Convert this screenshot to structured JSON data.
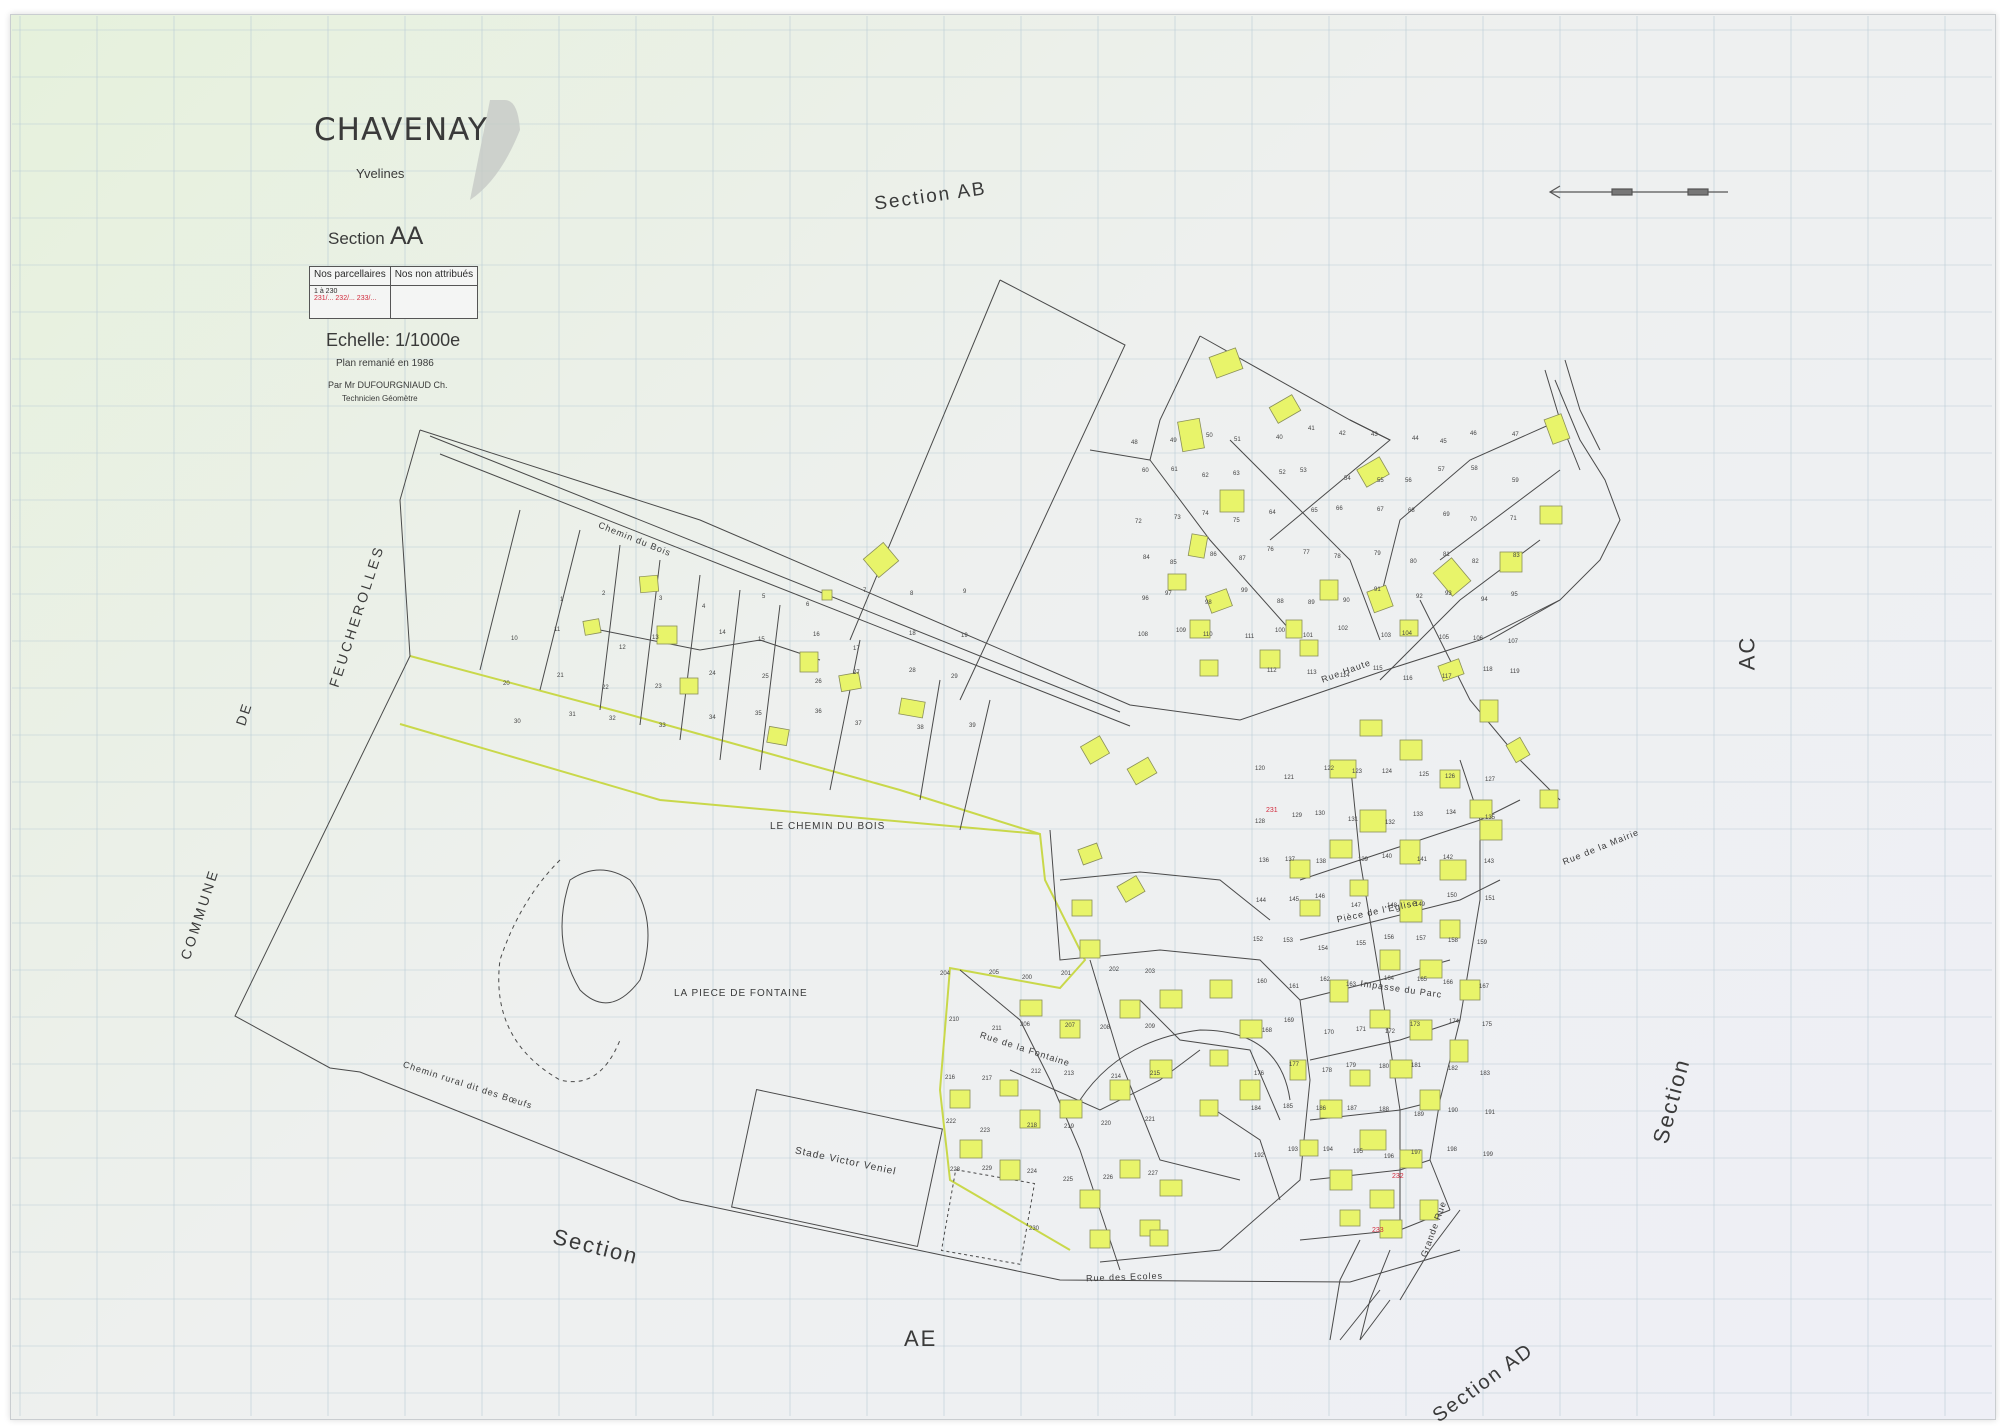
{
  "header": {
    "title": "CHAVENAY",
    "department": "Yvelines",
    "section_label": "Section",
    "section_code": "AA",
    "scale": "Echelle: 1/1000e",
    "plan_note": "Plan remanié en 1986",
    "author": "Par Mr DUFOURGNIAUD Ch.",
    "author_role": "Technicien Géomètre"
  },
  "legend_table": {
    "col1_header": "Nos parcellaires",
    "col2_header": "Nos non attribués",
    "col1_value": "1 à 230",
    "col1_red": "231/... 232/... 233/...",
    "col2_value": ""
  },
  "neighbors": {
    "top": "Section          AB",
    "right_upper": "AC",
    "right_lower": "Section",
    "bottom_left_1": "Section",
    "bottom_left_2": "AE",
    "bottom_right": "Section AD",
    "commune": "COMMUNE",
    "commune_de": "DE",
    "commune_name": "FEUCHEROLLES"
  },
  "places": {
    "chemin_du_bois": "LE CHEMIN DU BOIS",
    "piece_de_fontaine": "LA PIECE DE FONTAINE",
    "stade": "Stade   Victor   Veniel",
    "piece_eglise": "Pièce de l'Eglise",
    "impasse": "Impasse du Parc",
    "rue_des_ecoles": "Rue         des  Ecoles",
    "chemin_rural": "Chemin       rural        dit        des        Bœufs",
    "chemin_bois_road": "Chemin                 du                  Bois",
    "rue_fontaine": "Rue          de la        Fontaine",
    "grande_rue": "Grande  Rue",
    "rue_haute": "Rue         Haute",
    "rue_mairie": "Rue de la Mairie"
  },
  "colors": {
    "building_fill": "#e8f46a",
    "building_stroke": "#8a8f5a",
    "parcel_line": "#4a4a4a",
    "commune_border": "#c9d84a",
    "grid": "#b9cbd6",
    "red_number": "#d22a3c"
  },
  "parcel_numbers": [
    "1",
    "2",
    "3",
    "4",
    "5",
    "6",
    "7",
    "8",
    "9",
    "10",
    "11",
    "12",
    "13",
    "14",
    "15",
    "16",
    "17",
    "18",
    "19",
    "20",
    "21",
    "22",
    "23",
    "24",
    "25",
    "26",
    "27",
    "28",
    "29",
    "30",
    "31",
    "32",
    "33",
    "34",
    "35",
    "36",
    "37",
    "38",
    "39",
    "40",
    "41",
    "42",
    "43",
    "44",
    "45",
    "46",
    "47",
    "48",
    "49",
    "50",
    "51",
    "52",
    "53",
    "54",
    "55",
    "56",
    "57",
    "58",
    "59",
    "60",
    "61",
    "62",
    "63",
    "64",
    "65",
    "66",
    "67",
    "68",
    "69",
    "70",
    "71",
    "72",
    "73",
    "74",
    "75",
    "76",
    "77",
    "78",
    "79",
    "80",
    "81",
    "82",
    "83",
    "84",
    "85",
    "86",
    "87",
    "88",
    "89",
    "90",
    "91",
    "92",
    "93",
    "94",
    "95",
    "96",
    "97",
    "98",
    "99",
    "100",
    "101",
    "102",
    "103",
    "104",
    "105",
    "106",
    "107",
    "108",
    "109",
    "110",
    "111",
    "112",
    "113",
    "114",
    "115",
    "116",
    "117",
    "118",
    "119",
    "120",
    "121",
    "122",
    "123",
    "124",
    "125",
    "126",
    "127",
    "128",
    "129",
    "130",
    "131",
    "132",
    "133",
    "134",
    "135",
    "136",
    "137",
    "138",
    "139",
    "140",
    "141",
    "142",
    "143",
    "144",
    "145",
    "146",
    "147",
    "148",
    "149",
    "150",
    "151",
    "152",
    "153",
    "154",
    "155",
    "156",
    "157",
    "158",
    "159",
    "160",
    "161",
    "162",
    "163",
    "164",
    "165",
    "166",
    "167",
    "168",
    "169",
    "170",
    "171",
    "172",
    "173",
    "174",
    "175",
    "176",
    "177",
    "178",
    "179",
    "180",
    "181",
    "182",
    "183",
    "184",
    "185",
    "186",
    "187",
    "188",
    "189",
    "190",
    "191",
    "192",
    "193",
    "194",
    "195",
    "196",
    "197",
    "198",
    "199",
    "200",
    "201",
    "202",
    "203",
    "204",
    "205",
    "206",
    "207",
    "208",
    "209",
    "210",
    "211",
    "212",
    "213",
    "214",
    "215",
    "216",
    "217",
    "218",
    "219",
    "220",
    "221",
    "222",
    "223",
    "224",
    "225",
    "226",
    "227",
    "228",
    "229",
    "230"
  ],
  "red_numbers": [
    "231",
    "232",
    "233"
  ]
}
